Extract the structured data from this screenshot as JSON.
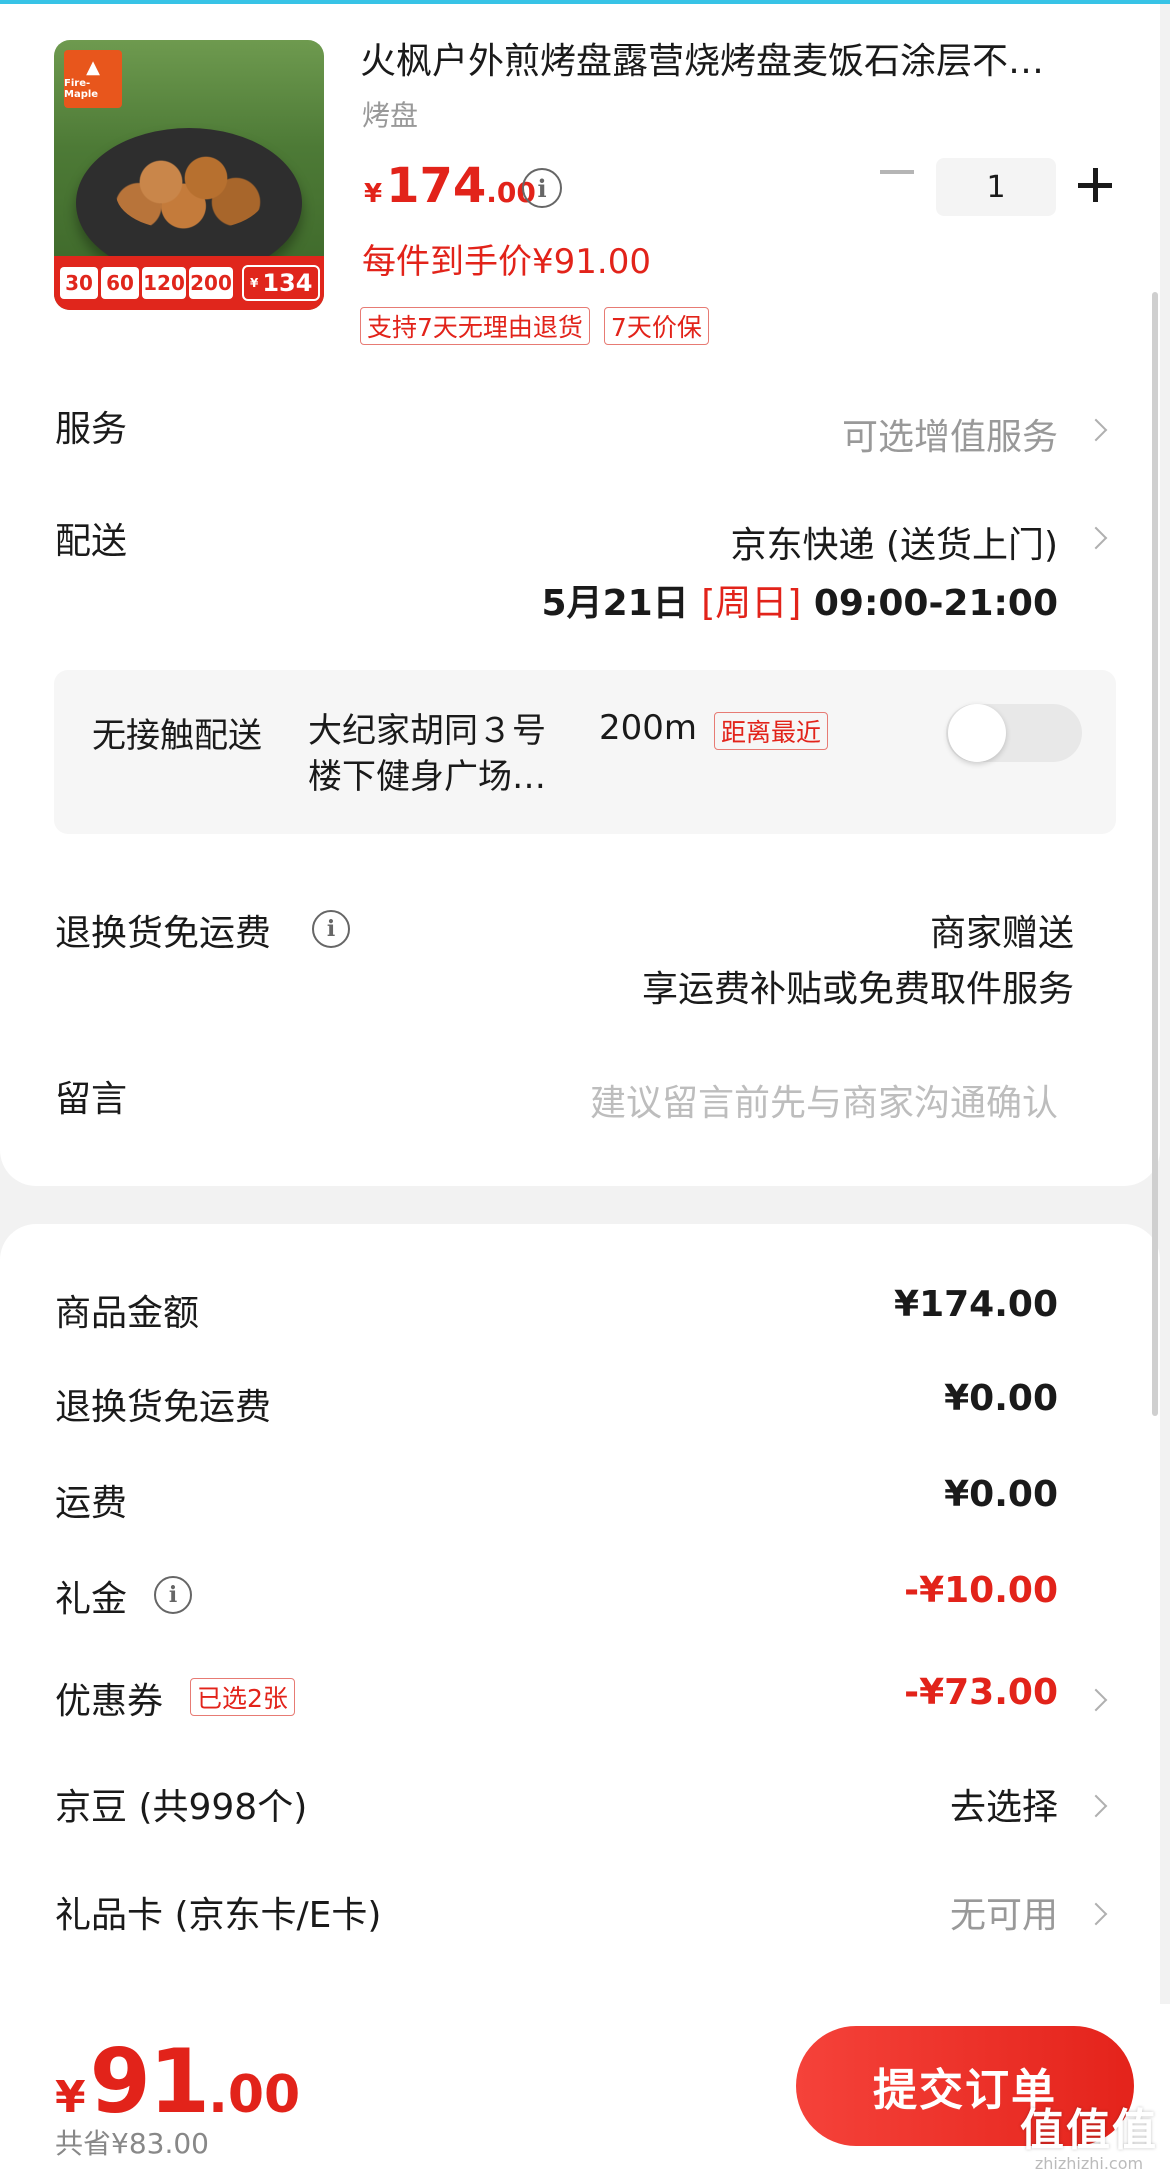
{
  "product": {
    "title": "火枫户外煎烤盘露营烧烤盘麦饭石涂层不…",
    "spec": "烤盘",
    "price_symbol": "¥",
    "price_int": "174",
    "price_dec": ".00",
    "unit_price": "每件到手价¥91.00",
    "tags": [
      "支持7天无理由退货",
      "7天价保"
    ],
    "quantity": "1",
    "image": {
      "brand": "Fire-Maple",
      "promo_chips": [
        "30",
        "60",
        "120",
        "200"
      ],
      "promo_symbol": "¥",
      "promo_final": "134"
    }
  },
  "rows": {
    "service_label": "服务",
    "service_value": "可选增值服务",
    "delivery_label": "配送",
    "delivery_value": "京东快递 (送货上门)",
    "delivery_date": "5月21日",
    "delivery_weekday": "[周日]",
    "delivery_hours": "09:00-21:00",
    "contactless": {
      "label": "无接触配送",
      "address": "大纪家胡同３号 楼下健身广场…",
      "distance": "200m",
      "tag": "距离最近",
      "enabled": false
    },
    "return_label": "退换货免运费",
    "return_value": "商家赠送",
    "return_sub": "享运费补贴或免费取件服务",
    "message_label": "留言",
    "message_placeholder": "建议留言前先与商家沟通确认"
  },
  "summary": {
    "goods_label": "商品金额",
    "goods_value": "¥174.00",
    "return_label": "退换货免运费",
    "return_value": "¥0.00",
    "shipping_label": "运费",
    "shipping_value": "¥0.00",
    "gift_label": "礼金",
    "gift_value": "-¥10.00",
    "coupon_label": "优惠券",
    "coupon_tag": "已选2张",
    "coupon_value": "-¥73.00",
    "jingdou_label": "京豆 (共998个)",
    "jingdou_value": "去选择",
    "giftcard_label": "礼品卡 (京东卡/E卡)",
    "giftcard_value": "无可用"
  },
  "footer": {
    "total_symbol": "¥",
    "total_int": "91",
    "total_dec": ".00",
    "saved": "共省¥83.00",
    "submit": "提交订单",
    "watermark_big": "值值值",
    "watermark_small": "zhizhizhi.com"
  },
  "colors": {
    "accent": "#e2231a",
    "muted": "#999999",
    "background": "#f2f2f2"
  }
}
